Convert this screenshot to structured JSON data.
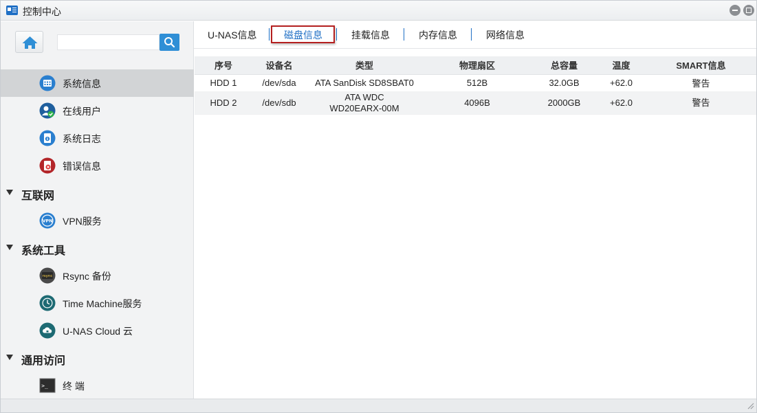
{
  "window": {
    "title": "控制中心"
  },
  "sidebar": {
    "items": [
      {
        "label": "系统信息",
        "icon": "system-info-icon",
        "active": true
      },
      {
        "label": "在线用户",
        "icon": "online-users-icon"
      },
      {
        "label": "系统日志",
        "icon": "system-log-icon"
      },
      {
        "label": "错误信息",
        "icon": "error-info-icon"
      }
    ],
    "sections": [
      {
        "label": "互联网",
        "items": [
          {
            "label": "VPN服务",
            "icon": "vpn-icon"
          }
        ]
      },
      {
        "label": "系统工具",
        "items": [
          {
            "label": "Rsync 备份",
            "icon": "rsync-icon",
            "icon_text": "rsync"
          },
          {
            "label": "Time Machine服务",
            "icon": "time-machine-icon"
          },
          {
            "label": "U-NAS Cloud 云",
            "icon": "cloud-icon"
          }
        ]
      },
      {
        "label": "通用访问",
        "items": [
          {
            "label": "终 端",
            "icon": "terminal-icon",
            "icon_text": ">_"
          }
        ]
      }
    ]
  },
  "tabs": [
    {
      "label": "U-NAS信息"
    },
    {
      "label": "磁盘信息",
      "active": true
    },
    {
      "label": "挂载信息"
    },
    {
      "label": "内存信息"
    },
    {
      "label": "网络信息"
    }
  ],
  "disk_table": {
    "columns": [
      "序号",
      "设备名",
      "类型",
      "物理扇区",
      "总容量",
      "温度",
      "SMART信息"
    ],
    "rows": [
      {
        "index": "HDD 1",
        "device": "/dev/sda",
        "type": [
          "ATA SanDisk SD8SBAT0"
        ],
        "sector": "512B",
        "capacity": "32.0GB",
        "temp": "+62.0",
        "smart": "警告"
      },
      {
        "index": "HDD 2",
        "device": "/dev/sdb",
        "type": [
          "ATA WDC",
          "WD20EARX-00M"
        ],
        "sector": "4096B",
        "capacity": "2000GB",
        "temp": "+62.0",
        "smart": "警告"
      }
    ]
  },
  "colors": {
    "accent": "#1f6fc5",
    "search_button": "#2f8fd6",
    "active_tab_border": "#b41f1f",
    "sidebar_bg": "#f2f3f4",
    "sidebar_active": "#d2d4d6"
  }
}
